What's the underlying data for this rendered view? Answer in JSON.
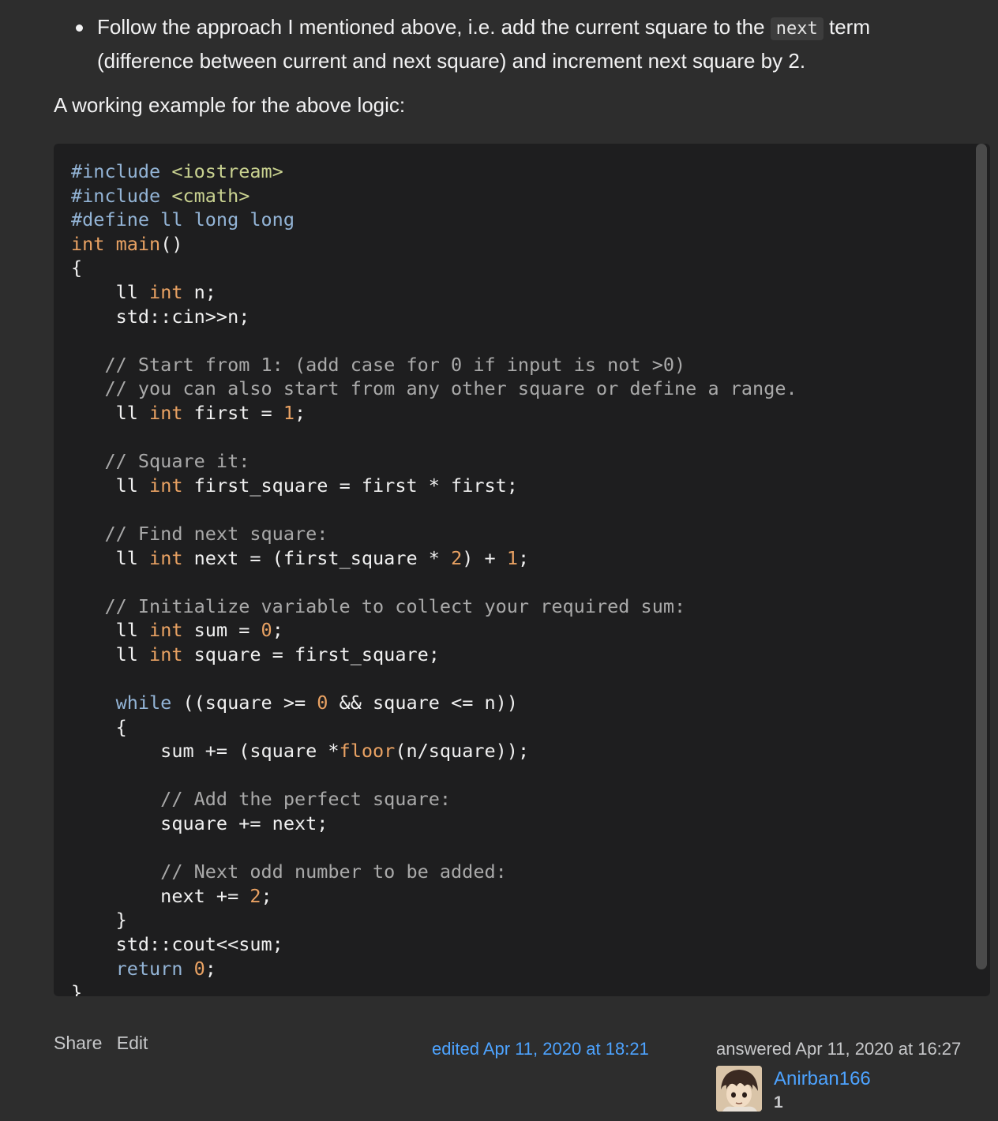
{
  "bullet": {
    "text_before": "Follow the approach I mentioned above, i.e. add the current square to the ",
    "inline_code": "next",
    "text_after": " term (difference between current and next square) and increment next square by 2."
  },
  "intro": "A working example for the above logic:",
  "code": {
    "lines": [
      "#include <iostream>",
      "#include <cmath>",
      "#define ll long long",
      "int main()",
      "{",
      "    ll int n;",
      "    std::cin>>n;",
      "",
      "   // Start from 1: (add case for 0 if input is not >0)",
      "   // you can also start from any other square or define a range.",
      "    ll int first = 1;",
      "",
      "   // Square it:",
      "    ll int first_square = first * first;",
      "",
      "   // Find next square:",
      "    ll int next = (first_square * 2) + 1;",
      "",
      "   // Initialize variable to collect your required sum:",
      "    ll int sum = 0;",
      "    ll int square = first_square;",
      "",
      "    while ((square >= 0 && square <= n))",
      "    {",
      "        sum += (square *floor(n/square));",
      "",
      "        // Add the perfect square:",
      "        square += next;",
      "",
      "        // Next odd number to be added:",
      "        next += 2;",
      "    }",
      "    std::cout<<sum;",
      "    return 0;",
      "}"
    ]
  },
  "post": {
    "share_label": "Share",
    "edit_label": "Edit",
    "edited": "edited Apr 11, 2020 at 18:21",
    "answered": "answered Apr 11, 2020 at 16:27",
    "username": "Anirban166",
    "reputation": "1"
  },
  "colors": {
    "background": "#2d2d2d",
    "code_background": "#1e1e1f",
    "link": "#4da3ff"
  }
}
